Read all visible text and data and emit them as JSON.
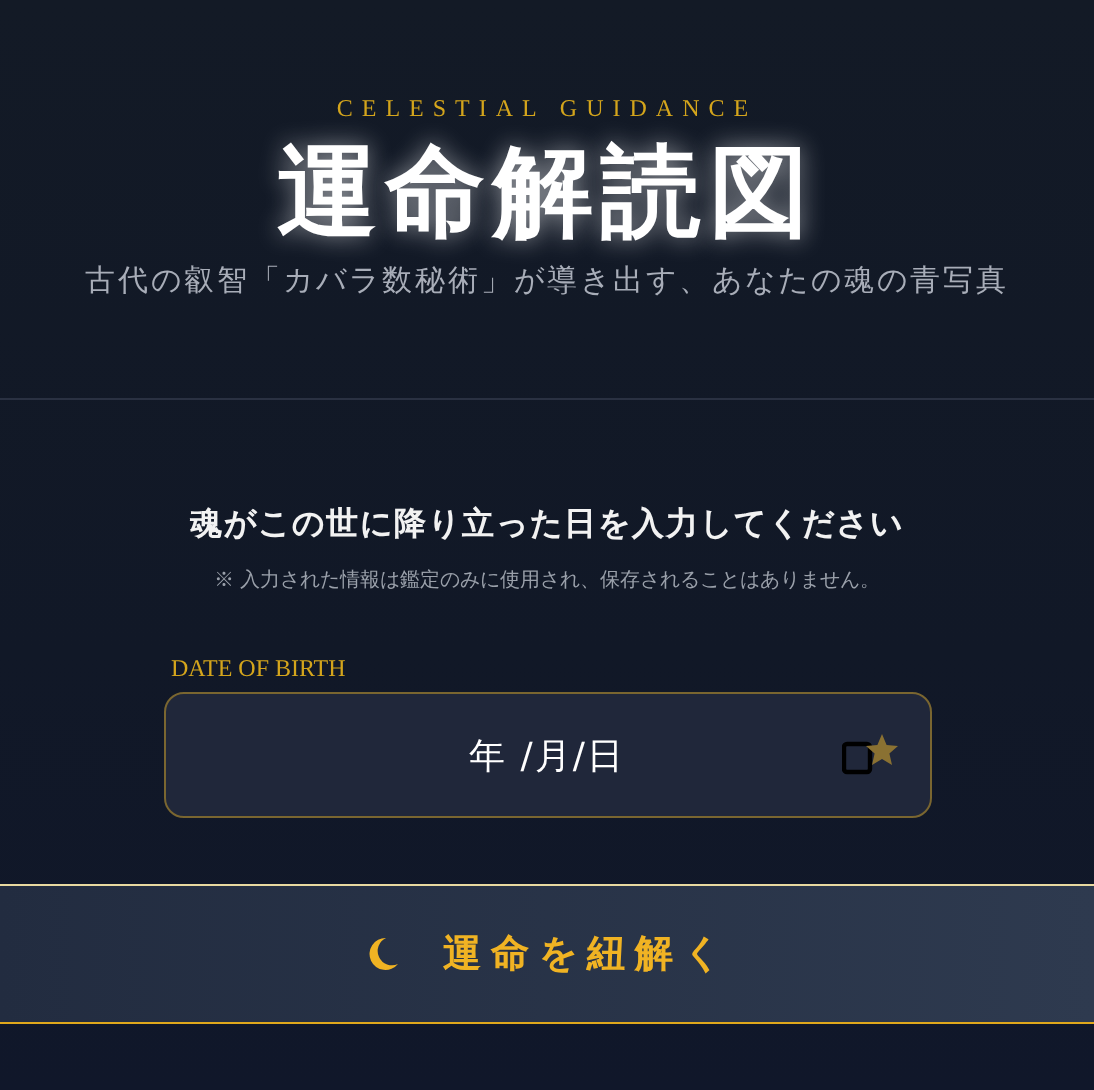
{
  "header": {
    "kicker": "CELESTIAL GUIDANCE",
    "title": "運命解読図",
    "subtitle": "古代の叡智「カバラ数秘術」が導き出す、あなたの魂の青写真"
  },
  "form": {
    "prompt": "魂がこの世に降り立った日を入力してください",
    "note": "※ 入力された情報は鑑定のみに使用され、保存されることはありません。",
    "field": {
      "label": "DATE OF BIRTH",
      "value": "年 /月/日"
    }
  },
  "submit": {
    "label": "運命を紐解く"
  }
}
